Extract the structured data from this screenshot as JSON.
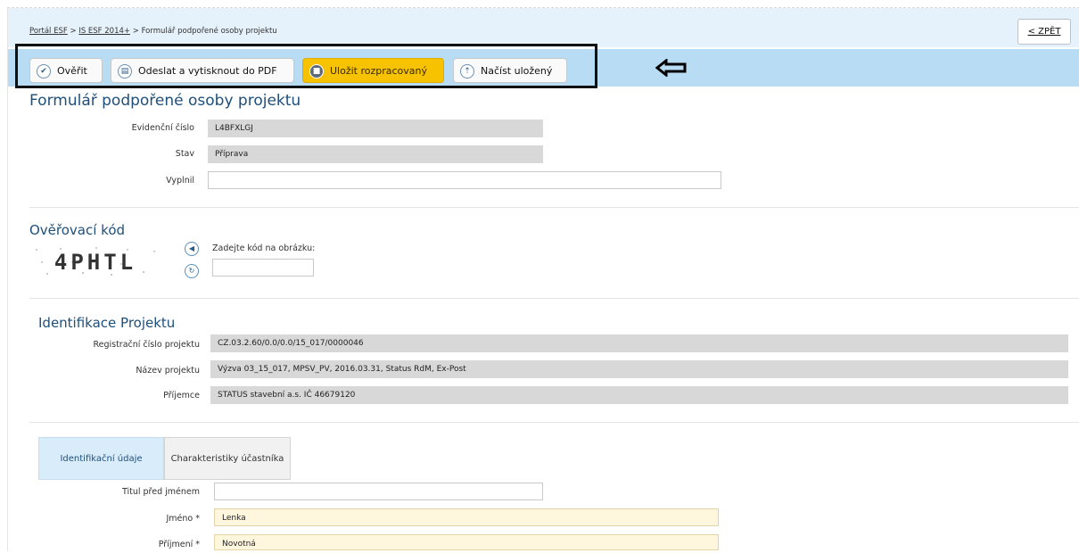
{
  "breadcrumb": {
    "item1": "Portál ESF",
    "sep1": " > ",
    "item2": "IS ESF 2014+",
    "sep2": " > ",
    "current": "Formulář podpořené osoby projektu"
  },
  "back_button": "< ZPĚT",
  "toolbar": {
    "verify": "Ověřit",
    "send_pdf": "Odeslat a vytisknout do PDF",
    "save_draft": "Uložit rozpracovaný",
    "load_saved": "Načíst uložený"
  },
  "page_title": "Formulář podpořené osoby projektu",
  "form_header": [
    {
      "label": "Evidenční číslo",
      "value": "L4BFXLGJ"
    },
    {
      "label": "Stav",
      "value": "Příprava"
    },
    {
      "label": "Vyplnil",
      "value": ""
    }
  ],
  "captcha": {
    "title": "Ověřovací kód",
    "image_text": "4PHTL",
    "prompt": "Zadejte kód na obrázku:",
    "value": ""
  },
  "project": {
    "title": "Identifikace Projektu",
    "fields": [
      {
        "label": "Registrační číslo projektu",
        "value": "CZ.03.2.60/0.0/0.0/15_017/0000046"
      },
      {
        "label": "Název projektu",
        "value": "Výzva 03_15_017, MPSV_PV, 2016.03.31, Status RdM, Ex-Post"
      },
      {
        "label": "Příjemce",
        "value": "STATUS stavební a.s. IČ 46679120"
      }
    ]
  },
  "tabs": [
    "Identifikační údaje",
    "Charakteristiky účastníka"
  ],
  "person": [
    {
      "label": "Titul před jménem",
      "value": ""
    },
    {
      "label": "Jméno *",
      "value": "Lenka"
    },
    {
      "label": "Příjmení *",
      "value": "Novotná"
    }
  ]
}
